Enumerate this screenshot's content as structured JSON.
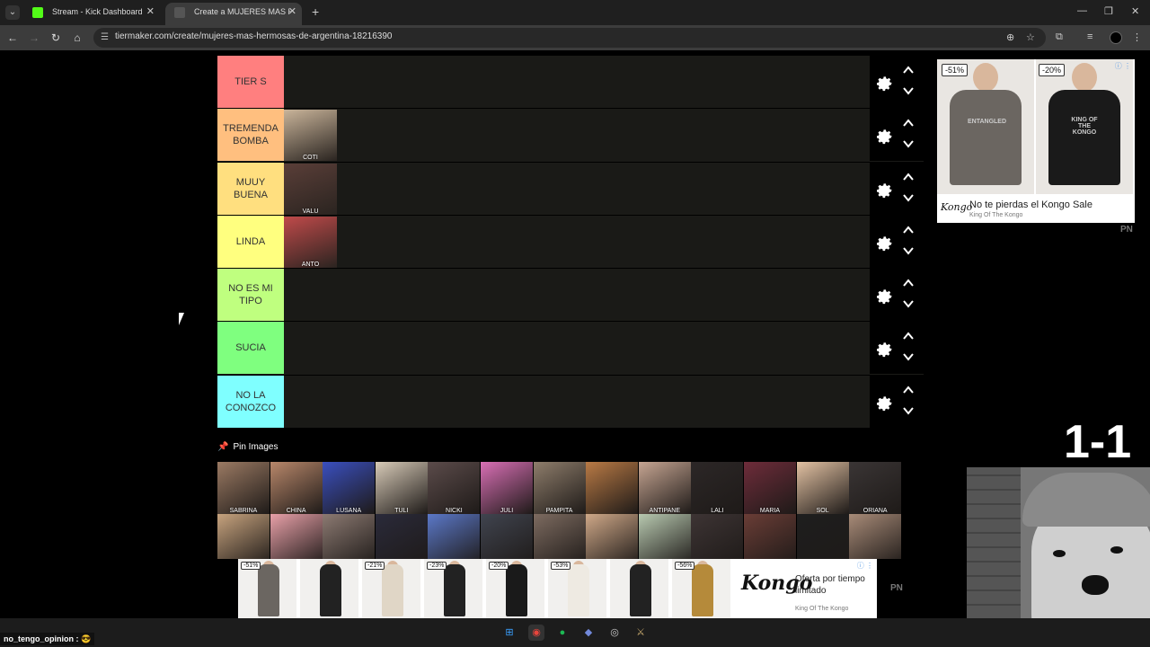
{
  "browser": {
    "tabs": [
      {
        "title": "Stream - Kick Dashboard",
        "active": false,
        "favicon_color": "#53fc18"
      },
      {
        "title": "Create a MUJERES MAS HERMOSAS",
        "active": true,
        "favicon_color": "#333333"
      }
    ],
    "url": "tiermaker.com/create/mujeres-mas-hermosas-de-argentina-18216390"
  },
  "tier_list": {
    "rows": [
      {
        "label": "TIER S",
        "color": "#ff7f7f",
        "items": []
      },
      {
        "label": "TREMENDA BOMBA",
        "color": "#ffbf7f",
        "items": [
          {
            "name": "COTI",
            "tone": "#c9b49a"
          }
        ]
      },
      {
        "label": "MUUY BUENA",
        "color": "#ffdf7f",
        "items": [
          {
            "name": "VALU",
            "tone": "#5a3e38"
          }
        ]
      },
      {
        "label": "LINDA",
        "color": "#ffff7f",
        "items": [
          {
            "name": "ANTO",
            "tone": "#c04a4a"
          }
        ]
      },
      {
        "label": "NO ES MI TIPO",
        "color": "#bfff7f",
        "items": []
      },
      {
        "label": "SUCIA",
        "color": "#7fff7f",
        "items": []
      },
      {
        "label": "NO LA CONOZCO",
        "color": "#7fffff",
        "items": []
      }
    ]
  },
  "pin_images_label": "Pin Images",
  "image_bank": [
    {
      "name": "SABRINA",
      "tone": "#9b7a63"
    },
    {
      "name": "CHINA",
      "tone": "#b8876a"
    },
    {
      "name": "LUSANA",
      "tone": "#3a4fbf"
    },
    {
      "name": "TULI",
      "tone": "#d8cbb8"
    },
    {
      "name": "NICKI",
      "tone": "#5b4b4a"
    },
    {
      "name": "JULI",
      "tone": "#d96fb5"
    },
    {
      "name": "PAMPITA",
      "tone": "#8e7d6b"
    },
    {
      "name": "",
      "tone": "#b97a45"
    },
    {
      "name": "ANTIPANE",
      "tone": "#c6a592"
    },
    {
      "name": "LALI",
      "tone": "#2c2727"
    },
    {
      "name": "MARIA",
      "tone": "#6e2c3a"
    },
    {
      "name": "SOL",
      "tone": "#e3c2a3"
    },
    {
      "name": "ORIANA",
      "tone": "#3a3535"
    },
    {
      "name": "",
      "tone": "#c7a37e"
    },
    {
      "name": "",
      "tone": "#e8a0a8"
    },
    {
      "name": "",
      "tone": "#8c7a72"
    },
    {
      "name": "",
      "tone": "#2a2a3a"
    },
    {
      "name": "",
      "tone": "#5b78c8"
    },
    {
      "name": "",
      "tone": "#40444f"
    },
    {
      "name": "",
      "tone": "#7d6b60"
    },
    {
      "name": "",
      "tone": "#cfa888"
    },
    {
      "name": "",
      "tone": "#b8c9b0"
    },
    {
      "name": "",
      "tone": "#3d3434"
    },
    {
      "name": "",
      "tone": "#6a3d36"
    },
    {
      "name": "",
      "tone": "#1e1e1e"
    },
    {
      "name": "",
      "tone": "#a88b78"
    }
  ],
  "side_ad": {
    "badges": [
      "-51%",
      "-20%"
    ],
    "title": "No te pierdas el Kongo Sale",
    "brand": "King Of The Kongo",
    "logo": "Kongo",
    "hoodie_colors": [
      "#6b6661",
      "#1a1a1a"
    ],
    "hood_prints": [
      "ENTANGLED",
      "KING OF THE KONGO"
    ]
  },
  "pn_label": "PN",
  "bottom_ad": {
    "products": [
      {
        "badge": "-51%",
        "color": "#6b6661"
      },
      {
        "badge": "",
        "color": "#222222"
      },
      {
        "badge": "-21%",
        "color": "#e0d6c6"
      },
      {
        "badge": "-23%",
        "color": "#222222"
      },
      {
        "badge": "-20%",
        "color": "#1a1a1a"
      },
      {
        "badge": "-53%",
        "color": "#eeeae2"
      },
      {
        "badge": "",
        "color": "#222222"
      },
      {
        "badge": "-56%",
        "color": "#b58a3a"
      }
    ],
    "logo": "Kongo",
    "title": "Oferta por tiempo limitado",
    "brand": "King Of The Kongo"
  },
  "stream_overlay": {
    "score": "1-1"
  },
  "taskbar": {
    "username": "no_tengo_opinion :",
    "apps": [
      "windows-start",
      "chrome",
      "spotify",
      "discord",
      "obs",
      "league"
    ]
  }
}
